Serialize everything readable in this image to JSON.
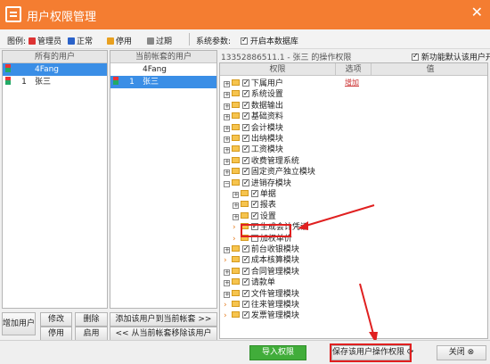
{
  "window": {
    "title": "用户权限管理",
    "close_glyph": "✕"
  },
  "toolbar": {
    "legend_label": "图例:",
    "legend": [
      {
        "label": "管理员",
        "color": "#d33"
      },
      {
        "label": "正常",
        "color": "#2a62c9"
      },
      {
        "label": "停用",
        "color": "#e8a020"
      },
      {
        "label": "过期",
        "color": "#888"
      }
    ],
    "params_label": "系统参数:",
    "enable_checkbox_label": "开启本数据库",
    "enable_checked": true
  },
  "all_users": {
    "header": "所有的用户",
    "rows": [
      {
        "id": "",
        "name": "4Fang",
        "selected": true
      },
      {
        "id": "1",
        "name": "张三",
        "selected": false
      }
    ]
  },
  "account_users": {
    "header": "当前帐套的用户",
    "rows": [
      {
        "id": "",
        "name": "4Fang",
        "selected": false
      },
      {
        "id": "1",
        "name": "张三",
        "selected": true
      }
    ]
  },
  "left_buttons": {
    "add": "增加用户",
    "edit": "修改",
    "delete": "删除",
    "disable": "停用",
    "enable": "启用"
  },
  "mid_buttons": {
    "add_to_account": "添加该用户到当前帐套 >>",
    "remove_from_account": "<< 从当前帐套移除该用户"
  },
  "perm": {
    "title": "13352886511.1 - 张三 的操作权限",
    "new_feature_label": "新功能默认该用户开放",
    "new_feature_checked": true,
    "col_perm": "权限",
    "col_option": "选项",
    "col_value": "值",
    "add_link": "增加"
  },
  "tree": [
    {
      "label": "下属用户",
      "level": 0,
      "plus": true,
      "checked": true
    },
    {
      "label": "系统设置",
      "level": 0,
      "plus": true,
      "checked": true
    },
    {
      "label": "数据输出",
      "level": 0,
      "plus": true,
      "checked": true
    },
    {
      "label": "基础资料",
      "level": 0,
      "plus": true,
      "checked": true
    },
    {
      "label": "会计模块",
      "level": 0,
      "plus": true,
      "checked": true
    },
    {
      "label": "出纳模块",
      "level": 0,
      "plus": true,
      "checked": true
    },
    {
      "label": "工资模块",
      "level": 0,
      "plus": true,
      "checked": true
    },
    {
      "label": "收费管理系统",
      "level": 0,
      "plus": true,
      "checked": true
    },
    {
      "label": "固定资产独立模块",
      "level": 0,
      "plus": true,
      "checked": true
    },
    {
      "label": "进销存模块",
      "level": 0,
      "plus": true,
      "checked": true,
      "expanded": true
    },
    {
      "label": "单据",
      "level": 1,
      "plus": true,
      "checked": true
    },
    {
      "label": "报表",
      "level": 1,
      "plus": true,
      "checked": true
    },
    {
      "label": "设置",
      "level": 1,
      "plus": true,
      "checked": true
    },
    {
      "label": "生成会计凭证",
      "level": 1,
      "plus": false,
      "checked": true
    },
    {
      "label": "加权单价",
      "level": 1,
      "plus": false,
      "checked": false,
      "highlight": true
    },
    {
      "label": "前台收银模块",
      "level": 0,
      "plus": true,
      "checked": true
    },
    {
      "label": "成本核算模块",
      "level": 0,
      "plus": false,
      "checked": true
    },
    {
      "label": "合同管理模块",
      "level": 0,
      "plus": true,
      "checked": true
    },
    {
      "label": "请款单",
      "level": 0,
      "plus": true,
      "checked": true
    },
    {
      "label": "文件管理模块",
      "level": 0,
      "plus": true,
      "checked": true
    },
    {
      "label": "往来管理模块",
      "level": 0,
      "plus": false,
      "checked": true
    },
    {
      "label": "发票管理模块",
      "level": 0,
      "plus": false,
      "checked": true
    }
  ],
  "bottom": {
    "import": "导入权限",
    "save": "保存该用户操作权限",
    "close": "关闭"
  }
}
